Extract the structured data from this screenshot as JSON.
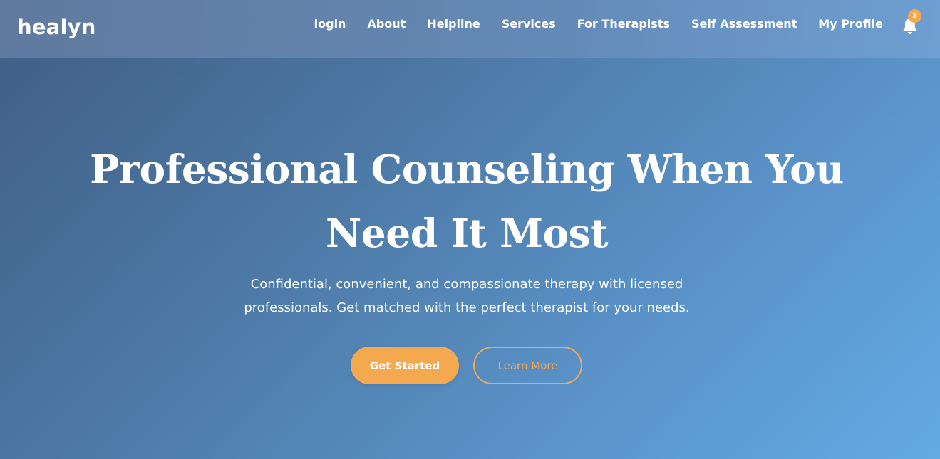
{
  "brand": {
    "name": "healyn"
  },
  "nav": {
    "items": [
      {
        "label": "login"
      },
      {
        "label": "About"
      },
      {
        "label": "Helpline"
      },
      {
        "label": "Services"
      },
      {
        "label": "For Therapists"
      },
      {
        "label": "Self Assessment"
      },
      {
        "label": "My Profile"
      }
    ],
    "notifications": {
      "icon": "bell-icon",
      "count": "3"
    }
  },
  "hero": {
    "title": "Professional Counseling When You Need It Most",
    "subtitle": "Confidential, convenient, and compassionate therapy with licensed professionals. Get matched with the perfect therapist for your needs.",
    "primary_button": "Get Started",
    "secondary_button": "Learn More"
  },
  "colors": {
    "accent": "#f5a94f",
    "background_start": "#3f5d85",
    "background_end": "#63aae5",
    "text": "#ffffff"
  }
}
